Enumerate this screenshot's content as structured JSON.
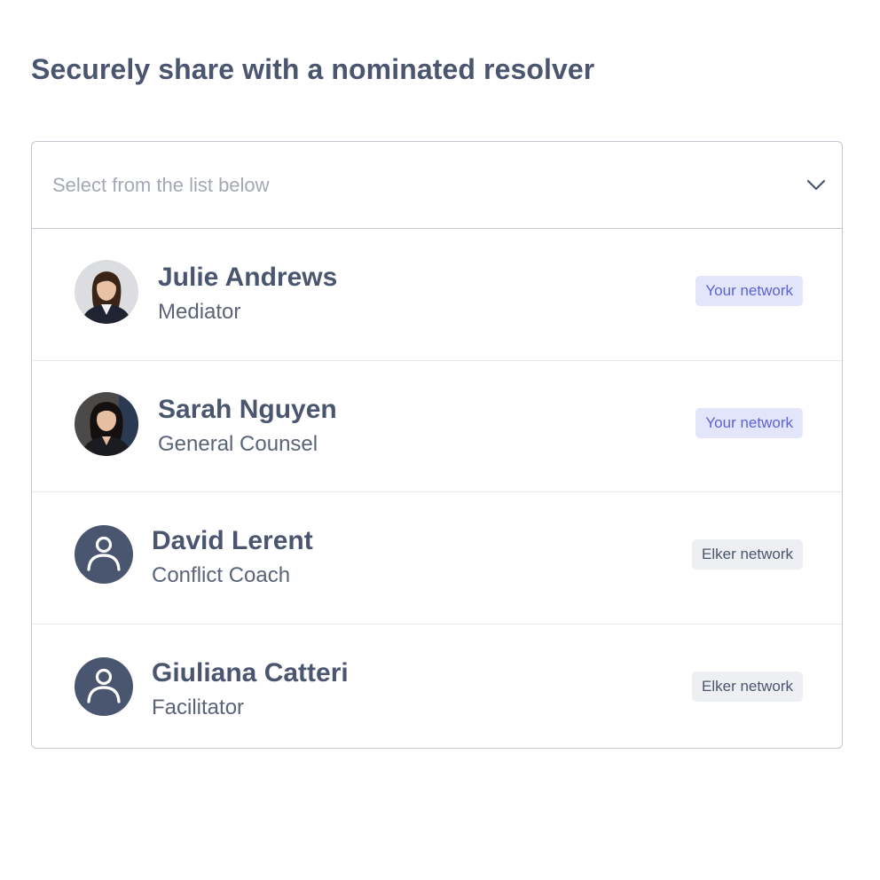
{
  "title": "Securely share with a nominated resolver",
  "select": {
    "placeholder": "Select from the list below",
    "chevron_icon": "chevron-down-icon"
  },
  "colors": {
    "text_primary": "#4a5570",
    "badge_your_network_bg": "#e3e5fb",
    "badge_your_network_text": "#5b63d6",
    "badge_elker_network_bg": "#eeeff2"
  },
  "resolvers": [
    {
      "name": "Julie Andrews",
      "role": "Mediator",
      "badge": "Your network",
      "avatar": "photo"
    },
    {
      "name": "Sarah Nguyen",
      "role": "General Counsel",
      "badge": "Your network",
      "avatar": "photo"
    },
    {
      "name": "David Lerent",
      "role": "Conflict Coach",
      "badge": "Elker network",
      "avatar": "user-icon"
    },
    {
      "name": "Giuliana Catteri",
      "role": "Facilitator",
      "badge": "Elker network",
      "avatar": "user-icon"
    }
  ]
}
